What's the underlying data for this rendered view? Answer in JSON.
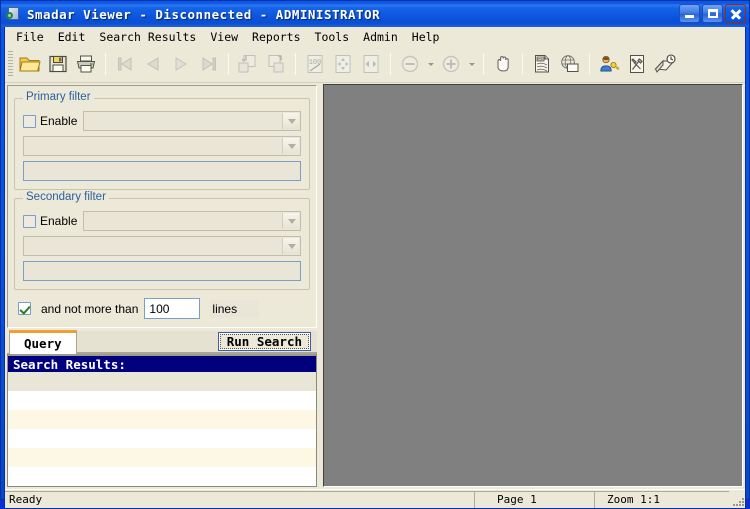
{
  "window": {
    "title": "Smadar Viewer - Disconnected - ADMINISTRATOR",
    "icon": "viewer-app-icon",
    "controls": {
      "minimize": "Minimize",
      "maximize": "Maximize",
      "close": "Close"
    }
  },
  "menubar": {
    "items": [
      {
        "label": "File"
      },
      {
        "label": "Edit"
      },
      {
        "label": "Search Results"
      },
      {
        "label": "View"
      },
      {
        "label": "Reports"
      },
      {
        "label": "Tools"
      },
      {
        "label": "Admin"
      },
      {
        "label": "Help"
      }
    ]
  },
  "toolbar": {
    "buttons": [
      {
        "name": "open-folder-icon",
        "tip": "Open",
        "enabled": true
      },
      {
        "name": "save-floppy-icon",
        "tip": "Save",
        "enabled": true
      },
      {
        "name": "print-icon",
        "tip": "Print",
        "enabled": true
      },
      {
        "name": "first-page-icon",
        "tip": "First",
        "enabled": false
      },
      {
        "name": "previous-page-icon",
        "tip": "Previous",
        "enabled": false
      },
      {
        "name": "next-page-icon",
        "tip": "Next",
        "enabled": false
      },
      {
        "name": "last-page-icon",
        "tip": "Last",
        "enabled": false
      },
      {
        "name": "insert-page-before-icon",
        "tip": "Insert Before",
        "enabled": false
      },
      {
        "name": "insert-page-after-icon",
        "tip": "Insert After",
        "enabled": false
      },
      {
        "name": "zoom-100-percent-icon",
        "tip": "Zoom 100%",
        "enabled": false
      },
      {
        "name": "fit-page-icon",
        "tip": "Fit Page",
        "enabled": false
      },
      {
        "name": "fit-width-icon",
        "tip": "Fit Width",
        "enabled": false
      },
      {
        "name": "zoom-out-icon",
        "tip": "Zoom Out",
        "enabled": false
      },
      {
        "name": "zoom-in-icon",
        "tip": "Zoom In",
        "enabled": false
      },
      {
        "name": "pan-hand-icon",
        "tip": "Pan",
        "enabled": true
      },
      {
        "name": "export-pdf-icon",
        "tip": "Export PDF",
        "enabled": true
      },
      {
        "name": "publish-web-icon",
        "tip": "Publish",
        "enabled": true
      },
      {
        "name": "user-permissions-icon",
        "tip": "Users",
        "enabled": true
      },
      {
        "name": "settings-tools-icon",
        "tip": "Settings",
        "enabled": true
      },
      {
        "name": "history-log-icon",
        "tip": "History",
        "enabled": true
      }
    ]
  },
  "primary_filter": {
    "title": "Primary filter",
    "enable_label": "Enable",
    "enabled": false,
    "field_combo_value": "",
    "operator_combo_value": "",
    "value_text": ""
  },
  "secondary_filter": {
    "title": "Secondary filter",
    "enable_label": "Enable",
    "enabled": false,
    "field_combo_value": "",
    "operator_combo_value": "",
    "value_text": ""
  },
  "limit": {
    "checked": true,
    "label": "and not more than",
    "value": "100",
    "units_label": "lines"
  },
  "tabs": {
    "active": "Query",
    "items": [
      {
        "label": "Query"
      }
    ],
    "run_search_label": "Run Search"
  },
  "results": {
    "header": "Search Results:",
    "rows": [
      "",
      "",
      "",
      "",
      ""
    ]
  },
  "statusbar": {
    "message": "Ready",
    "page": "Page 1",
    "zoom": "Zoom 1:1"
  },
  "colors": {
    "title_bar_blue": "#0a53de",
    "face": "#ece9d8",
    "viewer_gray": "#808080",
    "results_header_blue": "#00007e",
    "group_title_blue": "#2b5f9e",
    "tab_accent_orange": "#f0a030",
    "row_cream": "#fdf8e3"
  }
}
